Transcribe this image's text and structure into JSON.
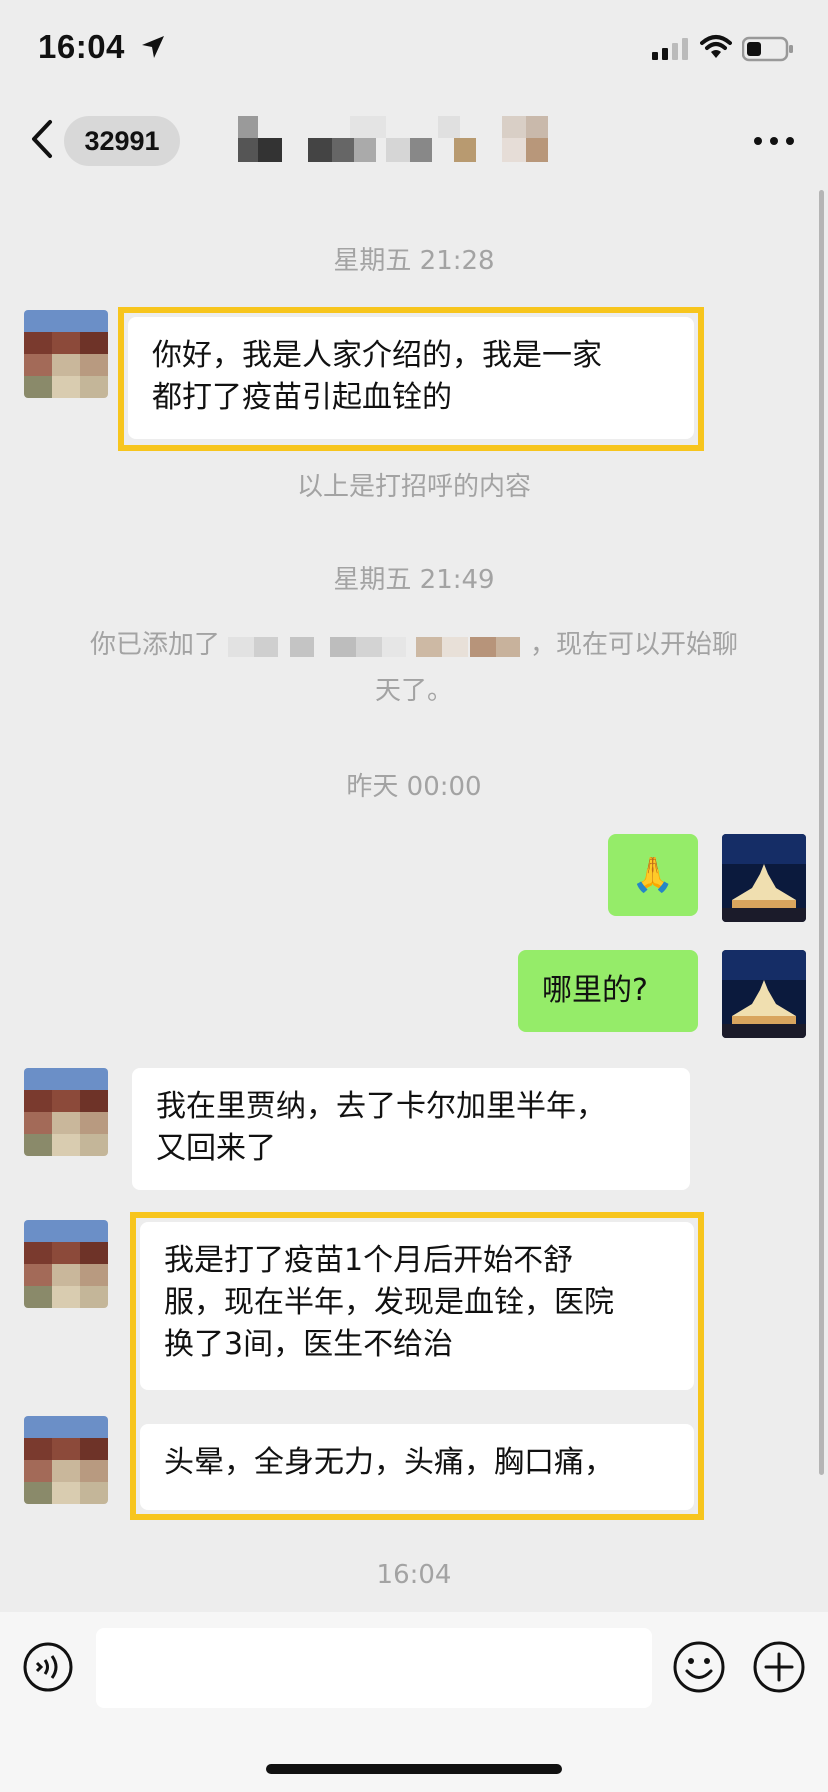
{
  "status_bar": {
    "time": "16:04"
  },
  "nav": {
    "unread_count": "32991",
    "back_icon": "chevron-left-icon",
    "more_icon": "ellipsis-icon"
  },
  "messages": [
    {
      "kind": "timestamp",
      "text": "星期五 21:28"
    },
    {
      "kind": "incoming",
      "lines": [
        "你好，我是人家介绍的，我是一家",
        "都打了疫苗引起血铨的"
      ]
    },
    {
      "kind": "system",
      "text": "以上是打招呼的内容"
    },
    {
      "kind": "timestamp",
      "text": "星期五 21:49"
    },
    {
      "kind": "system",
      "prefix": "你已添加了",
      "suffix": "，现在可以开始聊",
      "line2": "天了。"
    },
    {
      "kind": "timestamp",
      "text": "昨天 00:00"
    },
    {
      "kind": "outgoing",
      "text": "🙏"
    },
    {
      "kind": "outgoing",
      "text": "哪里的?"
    },
    {
      "kind": "incoming",
      "lines": [
        "我在里贾纳，去了卡尔加里半年，",
        "又回来了"
      ]
    },
    {
      "kind": "incoming",
      "lines": [
        "我是打了疫苗1个月后开始不舒",
        "服，现在半年，发现是血铨，医院",
        "换了3间，医生不给治"
      ]
    },
    {
      "kind": "incoming",
      "lines": [
        "头晕，全身无力，头痛，胸口痛，"
      ]
    },
    {
      "kind": "timestamp",
      "text": "16:04"
    }
  ],
  "input_bar": {
    "voice_icon": "voice-icon",
    "emoji_icon": "emoji-icon",
    "plus_icon": "plus-icon"
  },
  "colors": {
    "background": "#ededed",
    "outgoing_bubble": "#95ec69",
    "incoming_bubble": "#ffffff",
    "highlight_border": "#f7c51d"
  }
}
